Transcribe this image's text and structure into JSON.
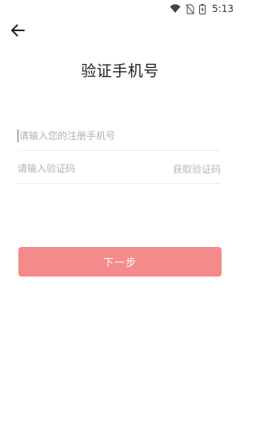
{
  "status_bar": {
    "time": "5:13",
    "icons": [
      "wifi-icon",
      "no-sim-icon",
      "battery-charging-icon"
    ]
  },
  "header": {
    "back_icon": "arrow-left-icon",
    "title": "验证手机号"
  },
  "form": {
    "phone_placeholder": "请输入您的注册手机号",
    "phone_value": "",
    "code_placeholder": "请输入验证码",
    "code_value": "",
    "get_code_label": "获取验证码"
  },
  "actions": {
    "next_label": "下一步"
  },
  "colors": {
    "primary_button": "#f58a8a",
    "placeholder": "#b2b2b2",
    "divider": "#ececec"
  }
}
